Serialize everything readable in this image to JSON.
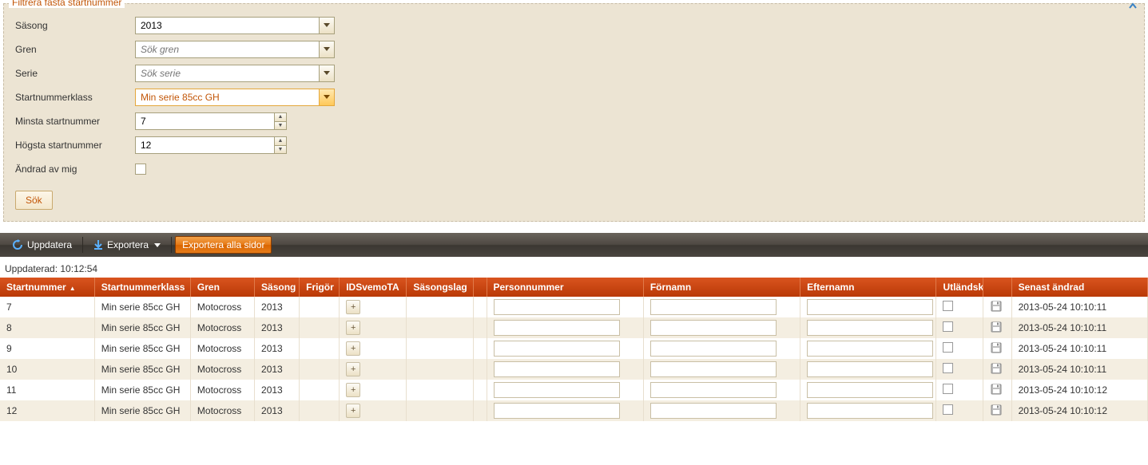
{
  "panel": {
    "legend": "Filtrera fasta startnummer",
    "labels": {
      "sasong": "Säsong",
      "gren": "Gren",
      "serie": "Serie",
      "startnummerklass": "Startnummerklass",
      "minsta": "Minsta startnummer",
      "hogsta": "Högsta startnummer",
      "andrad": "Ändrad av mig"
    },
    "values": {
      "sasong": "2013",
      "gren_placeholder": "Sök gren",
      "serie_placeholder": "Sök serie",
      "startnummerklass": "Min serie 85cc GH",
      "minsta": "7",
      "hogsta": "12",
      "andrad_checked": false
    },
    "search_button": "Sök"
  },
  "toolbar": {
    "uppdatera": "Uppdatera",
    "exportera": "Exportera",
    "exportera_alla": "Exportera alla sidor"
  },
  "updated_label": "Uppdaterad: 10:12:54",
  "grid": {
    "headers": {
      "startnummer": "Startnummer",
      "startnummerklass": "Startnummerklass",
      "gren": "Gren",
      "sasong": "Säsong",
      "frigor": "Frigör",
      "idsvemota": "IDSvemoTA",
      "sasongslag": "Säsongslag",
      "personnummer": "Personnummer",
      "fornamn": "Förnamn",
      "efternamn": "Efternamn",
      "utlandsk": "Utländsk",
      "senast": "Senast ändrad"
    },
    "rows": [
      {
        "startnummer": "7",
        "klass": "Min serie 85cc GH",
        "gren": "Motocross",
        "sasong": "2013",
        "senast": "2013-05-24 10:10:11"
      },
      {
        "startnummer": "8",
        "klass": "Min serie 85cc GH",
        "gren": "Motocross",
        "sasong": "2013",
        "senast": "2013-05-24 10:10:11"
      },
      {
        "startnummer": "9",
        "klass": "Min serie 85cc GH",
        "gren": "Motocross",
        "sasong": "2013",
        "senast": "2013-05-24 10:10:11"
      },
      {
        "startnummer": "10",
        "klass": "Min serie 85cc GH",
        "gren": "Motocross",
        "sasong": "2013",
        "senast": "2013-05-24 10:10:11"
      },
      {
        "startnummer": "11",
        "klass": "Min serie 85cc GH",
        "gren": "Motocross",
        "sasong": "2013",
        "senast": "2013-05-24 10:10:12"
      },
      {
        "startnummer": "12",
        "klass": "Min serie 85cc GH",
        "gren": "Motocross",
        "sasong": "2013",
        "senast": "2013-05-24 10:10:12"
      }
    ]
  }
}
